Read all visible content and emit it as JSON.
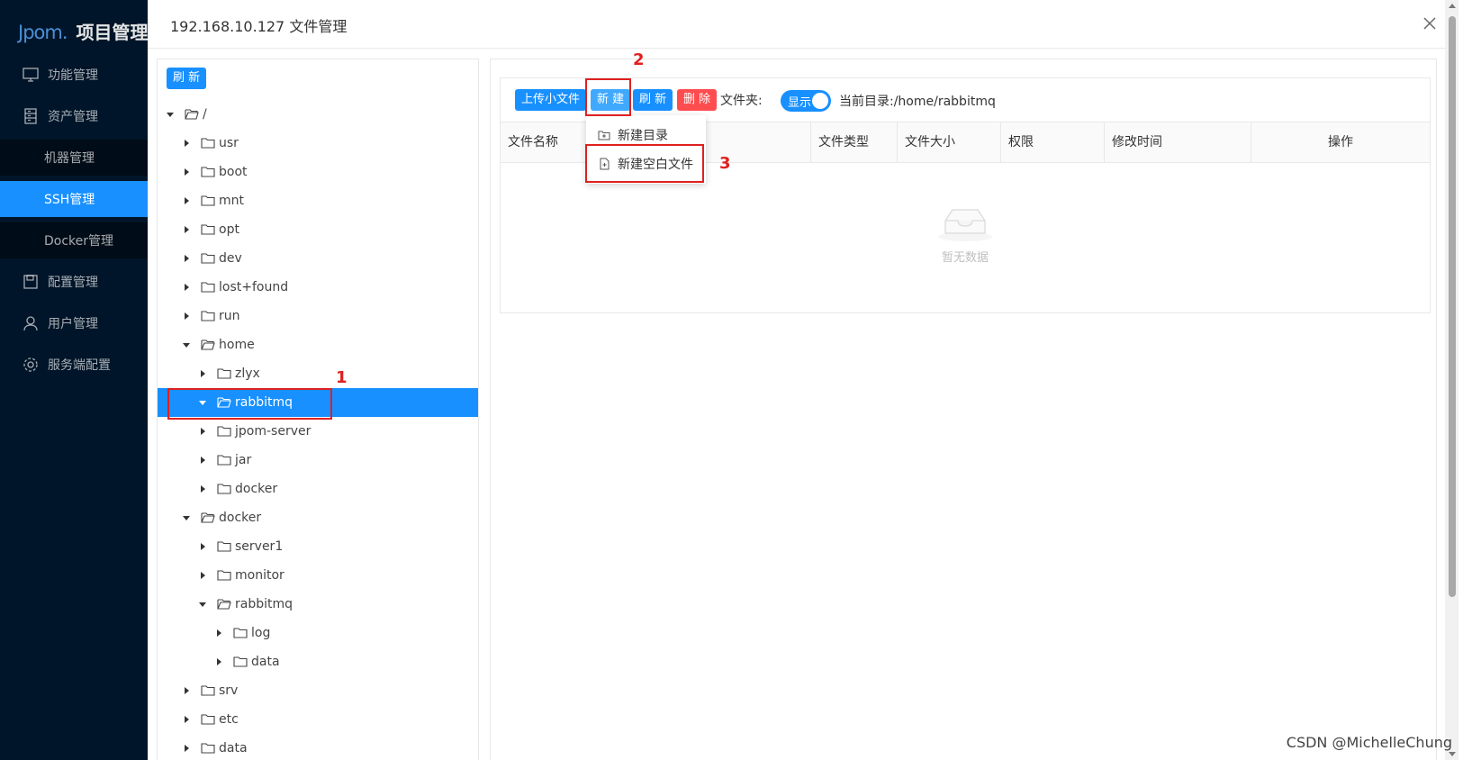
{
  "sidebar": {
    "brand": "Jpom.",
    "title": "项目管理",
    "items": [
      {
        "label": "功能管理",
        "icon": "monitor-icon"
      },
      {
        "label": "资产管理",
        "icon": "database-icon"
      },
      {
        "label": "配置管理",
        "icon": "save-icon"
      },
      {
        "label": "用户管理",
        "icon": "user-icon"
      },
      {
        "label": "服务端配置",
        "icon": "settings-icon"
      }
    ],
    "subitems": [
      {
        "label": "机器管理"
      },
      {
        "label": "SSH管理"
      },
      {
        "label": "Docker管理"
      }
    ]
  },
  "modal": {
    "title": "192.168.10.127 文件管理"
  },
  "tree": {
    "refresh_label": "刷 新",
    "nodes": [
      {
        "label": "/"
      },
      {
        "label": "usr"
      },
      {
        "label": "boot"
      },
      {
        "label": "mnt"
      },
      {
        "label": "opt"
      },
      {
        "label": "dev"
      },
      {
        "label": "lost+found"
      },
      {
        "label": "run"
      },
      {
        "label": "home"
      },
      {
        "label": "zlyx"
      },
      {
        "label": "rabbitmq"
      },
      {
        "label": "jpom-server"
      },
      {
        "label": "jar"
      },
      {
        "label": "docker"
      },
      {
        "label": "docker"
      },
      {
        "label": "server1"
      },
      {
        "label": "monitor"
      },
      {
        "label": "rabbitmq"
      },
      {
        "label": "log"
      },
      {
        "label": "data"
      },
      {
        "label": "srv"
      },
      {
        "label": "etc"
      },
      {
        "label": "data"
      }
    ]
  },
  "toolbar": {
    "upload_label": "上传小文件",
    "new_label": "新 建",
    "refresh_label": "刷 新",
    "delete_label": "删 除",
    "folder_label": "文件夹:",
    "switch_label": "显示",
    "current_dir": "当前目录:/home/rabbitmq"
  },
  "dropdown": {
    "new_dir": "新建目录",
    "new_file": "新建空白文件"
  },
  "table": {
    "columns": [
      "文件名称",
      "文件类型",
      "文件大小",
      "权限",
      "修改时间",
      "操作"
    ],
    "empty_text": "暂无数据"
  },
  "annotations": {
    "one": "1",
    "two": "2",
    "three": "3",
    "color": "#e02020"
  },
  "watermark": "CSDN @MichelleChung",
  "colors": {
    "primary": "#1890ff",
    "danger": "#ff4d4f",
    "sidebar_bg": "#001529"
  }
}
